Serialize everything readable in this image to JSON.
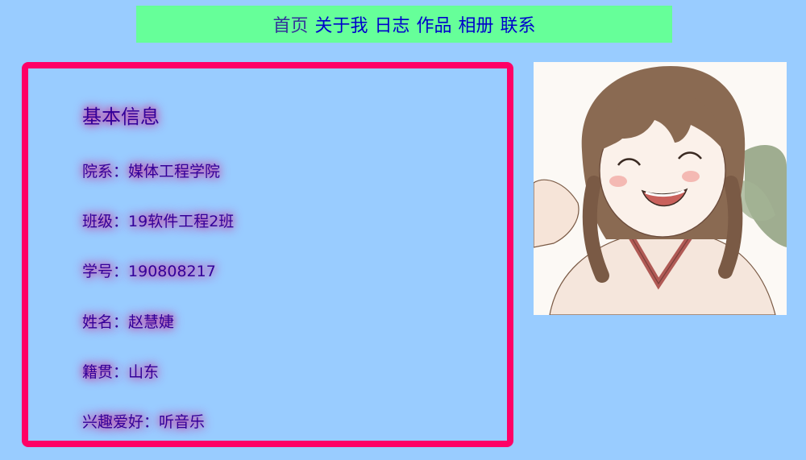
{
  "nav": {
    "items": [
      "首页",
      "关于我",
      "日志",
      "作品",
      "相册",
      "联系"
    ]
  },
  "info": {
    "title": "基本信息",
    "rows": [
      {
        "label": "院系",
        "sep": "：",
        "value": "媒体工程学院"
      },
      {
        "label": "班级",
        "sep": "：",
        "value": "19软件工程2班"
      },
      {
        "label": "学号",
        "sep": "：",
        "value": "190808217"
      },
      {
        "label": "姓名",
        "sep": "：",
        "value": "赵慧婕"
      },
      {
        "label": "籍贯",
        "sep": "：",
        "value": "山东"
      },
      {
        "label": "兴趣爱好",
        "sep": "：",
        "value": "听音乐"
      }
    ]
  },
  "colors": {
    "background": "#99ccff",
    "nav_background": "#66ff99",
    "border": "#ff0066",
    "text": "#330099",
    "text_glow": "#cc3399"
  },
  "avatar": {
    "icon": "smiling-anime-girl-illustration"
  }
}
